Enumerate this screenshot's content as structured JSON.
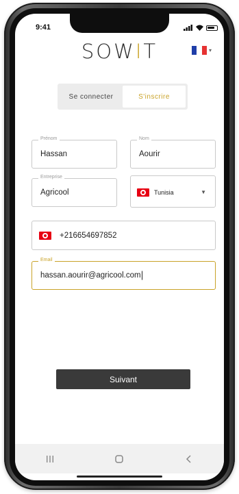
{
  "status_bar": {
    "time": "9:41"
  },
  "brand": {
    "logo_prefix": "SOW",
    "logo_mid": "I",
    "logo_suffix": "T",
    "accent_color": "#c9a227"
  },
  "language": {
    "flag_icon": "france-flag-icon"
  },
  "auth_tabs": {
    "login_label": "Se connecter",
    "signup_label": "S'inscrire",
    "active": "signup"
  },
  "form": {
    "first_name": {
      "label": "Prénom",
      "value": "Hassan"
    },
    "last_name": {
      "label": "Nom",
      "value": "Aourir"
    },
    "company": {
      "label": "Entreprise",
      "value": "Agricool"
    },
    "country": {
      "value": "Tunisia",
      "flag_icon": "tunisia-flag-icon"
    },
    "phone": {
      "value": "+216654697852",
      "flag_icon": "tunisia-flag-icon"
    },
    "email": {
      "label": "Email",
      "value": "hassan.aourir@agricool.com"
    }
  },
  "actions": {
    "next_label": "Suivant",
    "next_color": "#3a3a3a"
  },
  "nav_bar": {
    "icons": [
      "recent-apps-icon",
      "home-icon",
      "back-icon"
    ]
  }
}
